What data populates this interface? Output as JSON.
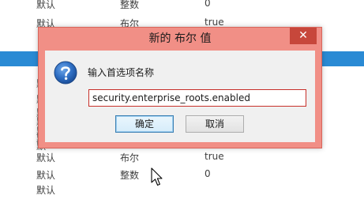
{
  "background_list": {
    "rows": [
      {
        "status": "默认",
        "type": "整数",
        "value": "0"
      },
      {
        "status": "默认",
        "type": "布尔",
        "value": "true"
      },
      {
        "status": "默认",
        "type": "布尔",
        "value": "true"
      },
      {
        "status": "默认",
        "type": "整数",
        "value": "0"
      }
    ],
    "fragments": [
      "默认",
      "默认",
      "默认",
      "默认",
      "默认",
      "默认",
      "默认"
    ],
    "selection_color": "#2a8ad4"
  },
  "dialog": {
    "title": "新的 布尔 值",
    "close_label": "✕",
    "prompt": "输入首选项名称",
    "input_value": "security.enterprise_roots.enabled",
    "ok_label": "确定",
    "cancel_label": "取消",
    "icon": "question-icon",
    "frame_color": "#f18f86",
    "close_color": "#c7473b"
  }
}
